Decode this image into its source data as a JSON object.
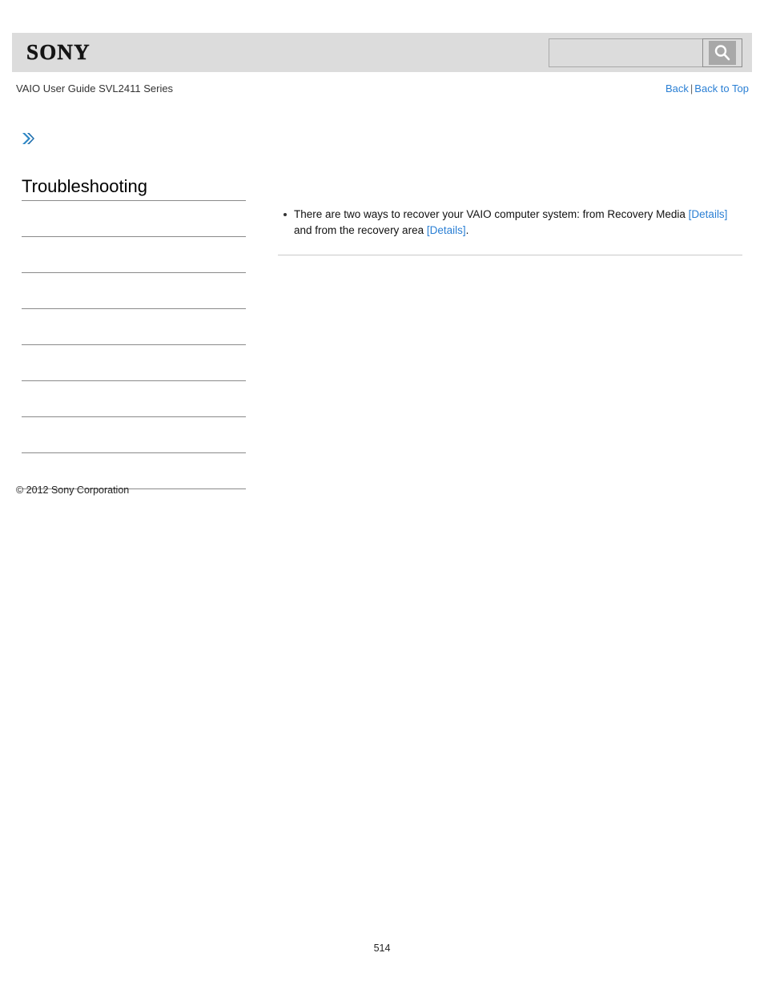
{
  "header": {
    "logo_text": "SONY",
    "search": {
      "value": "",
      "placeholder": "",
      "icon": "search-icon"
    }
  },
  "subheader": {
    "guide_title": "VAIO User Guide SVL2411 Series",
    "links": {
      "back": "Back",
      "separator": "|",
      "back_to_top": "Back to Top"
    }
  },
  "breadcrumb": {
    "icon": "double-chevron-right-icon"
  },
  "sidebar": {
    "heading": "Troubleshooting",
    "items": [
      {
        "label": ""
      },
      {
        "label": ""
      },
      {
        "label": ""
      },
      {
        "label": ""
      },
      {
        "label": ""
      },
      {
        "label": ""
      },
      {
        "label": ""
      },
      {
        "label": ""
      }
    ],
    "copyright": "© 2012 Sony Corporation"
  },
  "main": {
    "bullets": [
      {
        "text_part_1": "There are two ways to recover your VAIO computer system: from Recovery Media ",
        "link_1": "[Details]",
        "text_part_2": " and from the recovery area ",
        "link_2": "[Details]",
        "text_part_3": "."
      }
    ]
  },
  "footer": {
    "page_number": "514"
  },
  "colors": {
    "header_background": "#dcdcdc",
    "link_blue": "#2a7fd4",
    "chevron_blue": "#2b86c5",
    "divider_gray": "#8a8a8a",
    "content_divider_gray": "#c9c9c9"
  }
}
